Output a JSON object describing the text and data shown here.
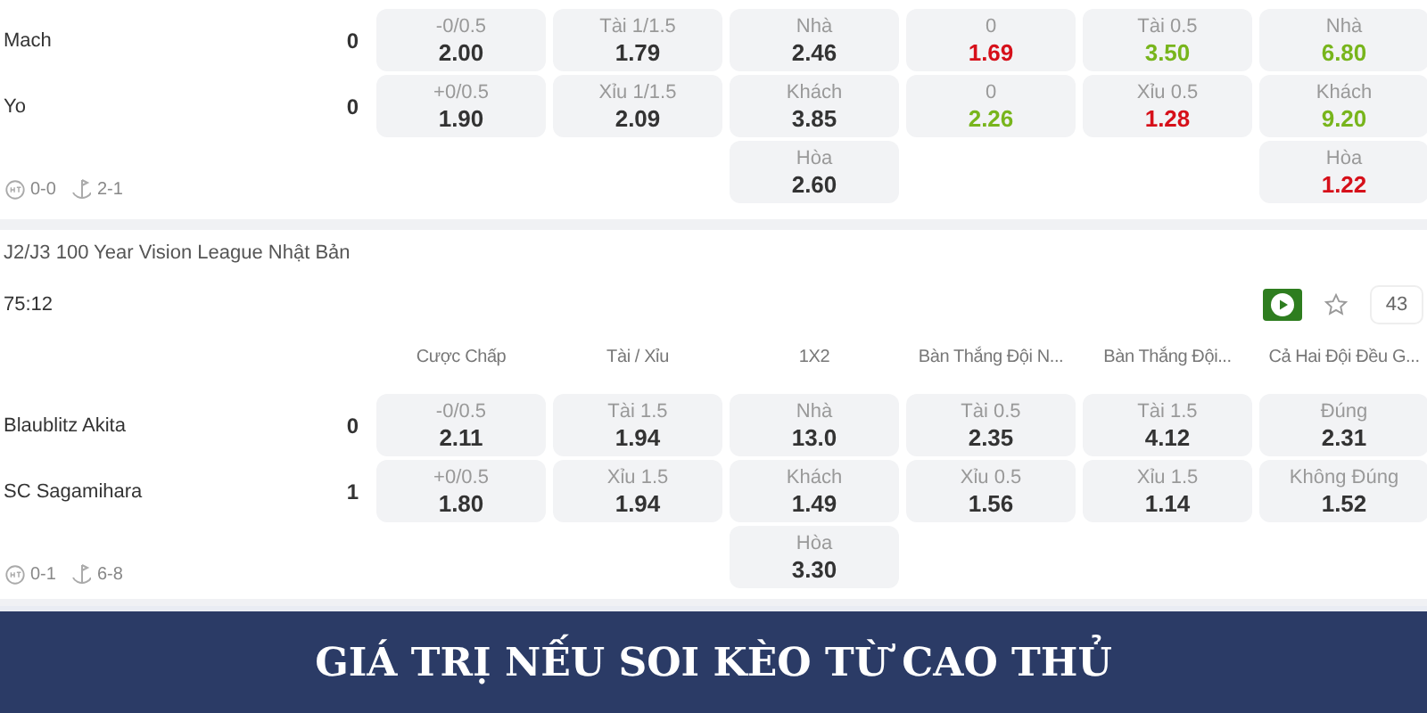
{
  "matches": [
    {
      "teams": [
        {
          "name": "Mach",
          "score": "0"
        },
        {
          "name": "Yo",
          "score": "0"
        }
      ],
      "markets": [
        {
          "options": [
            {
              "label": "-0/0.5",
              "odds": "2.00",
              "color": "#333333"
            },
            {
              "label": "+0/0.5",
              "odds": "1.90",
              "color": "#333333"
            }
          ]
        },
        {
          "options": [
            {
              "label": "Tài 1/1.5",
              "odds": "1.79",
              "color": "#333333"
            },
            {
              "label": "Xỉu 1/1.5",
              "odds": "2.09",
              "color": "#333333"
            }
          ]
        },
        {
          "options": [
            {
              "label": "Nhà",
              "odds": "2.46",
              "color": "#333333"
            },
            {
              "label": "Khách",
              "odds": "3.85",
              "color": "#333333"
            },
            {
              "label": "Hòa",
              "odds": "2.60",
              "color": "#333333"
            }
          ]
        },
        {
          "options": [
            {
              "label": "0",
              "odds": "1.69",
              "color": "#d6101a"
            },
            {
              "label": "0",
              "odds": "2.26",
              "color": "#78b51c"
            }
          ]
        },
        {
          "options": [
            {
              "label": "Tài 0.5",
              "odds": "3.50",
              "color": "#78b51c"
            },
            {
              "label": "Xỉu 0.5",
              "odds": "1.28",
              "color": "#d6101a"
            }
          ]
        },
        {
          "options": [
            {
              "label": "Nhà",
              "odds": "6.80",
              "color": "#78b51c"
            },
            {
              "label": "Khách",
              "odds": "9.20",
              "color": "#78b51c"
            },
            {
              "label": "Hòa",
              "odds": "1.22",
              "color": "#d6101a"
            }
          ]
        }
      ],
      "halftime": "0-0",
      "corners": "2-1"
    },
    {
      "league": "J2/J3 100 Year Vision League Nhật Bản",
      "time": "75:12",
      "live_count": "43",
      "headers": [
        "Cược Chấp",
        "Tài / Xỉu",
        "1X2",
        "Bàn Thắng Đội N...",
        "Bàn Thắng Đội...",
        "Cả Hai Đội Đều G..."
      ],
      "teams": [
        {
          "name": "Blaublitz Akita",
          "score": "0"
        },
        {
          "name": "SC Sagamihara",
          "score": "1"
        }
      ],
      "markets": [
        {
          "options": [
            {
              "label": "-0/0.5",
              "odds": "2.11",
              "color": "#333333"
            },
            {
              "label": "+0/0.5",
              "odds": "1.80",
              "color": "#333333"
            }
          ]
        },
        {
          "options": [
            {
              "label": "Tài 1.5",
              "odds": "1.94",
              "color": "#333333"
            },
            {
              "label": "Xỉu 1.5",
              "odds": "1.94",
              "color": "#333333"
            }
          ]
        },
        {
          "options": [
            {
              "label": "Nhà",
              "odds": "13.0",
              "color": "#333333"
            },
            {
              "label": "Khách",
              "odds": "1.49",
              "color": "#333333"
            },
            {
              "label": "Hòa",
              "odds": "3.30",
              "color": "#333333"
            }
          ]
        },
        {
          "options": [
            {
              "label": "Tài 0.5",
              "odds": "2.35",
              "color": "#333333"
            },
            {
              "label": "Xỉu 0.5",
              "odds": "1.56",
              "color": "#333333"
            }
          ]
        },
        {
          "options": [
            {
              "label": "Tài 1.5",
              "odds": "4.12",
              "color": "#333333"
            },
            {
              "label": "Xỉu 1.5",
              "odds": "1.14",
              "color": "#333333"
            }
          ]
        },
        {
          "options": [
            {
              "label": "Đúng",
              "odds": "2.31",
              "color": "#333333"
            },
            {
              "label": "Không Đúng",
              "odds": "1.52",
              "color": "#333333"
            }
          ]
        }
      ],
      "halftime": "0-1",
      "corners": "6-8"
    }
  ],
  "banner": "GIÁ TRỊ NẾU SOI KÈO TỪ CAO THỦ"
}
